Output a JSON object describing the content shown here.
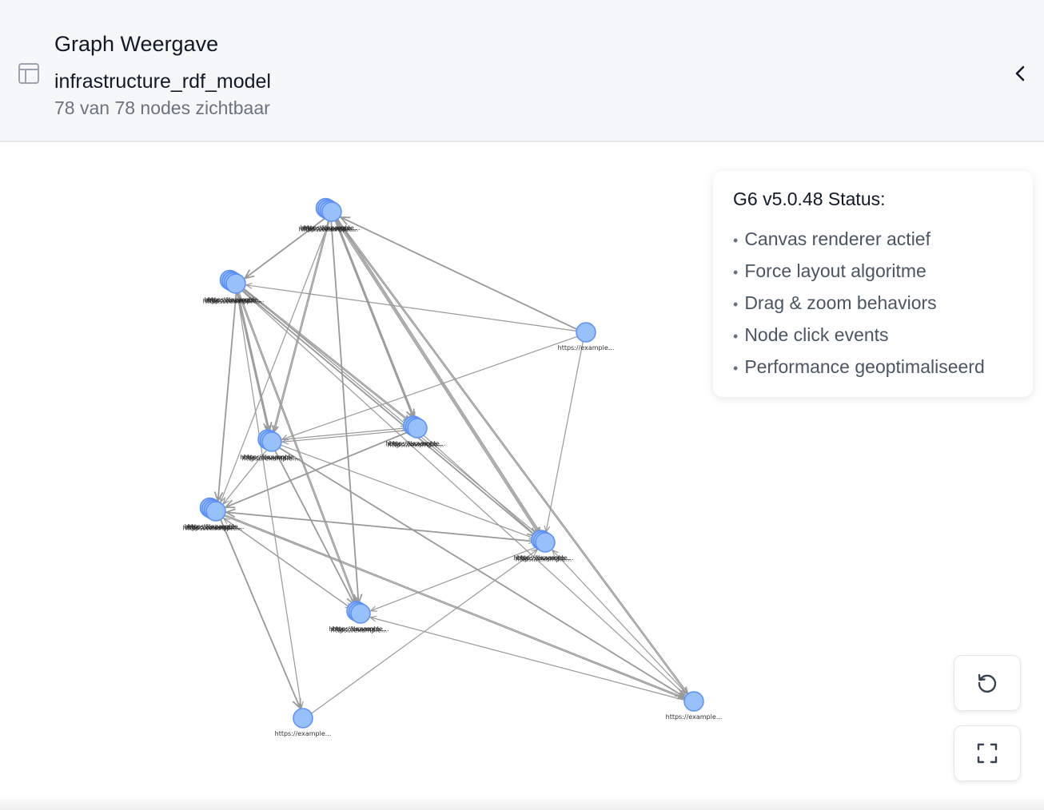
{
  "header": {
    "title": "Graph Weergave",
    "model_name": "infrastructure_rdf_model",
    "node_count": "78 van 78 nodes zichtbaar",
    "layout_icon": "layout-panel-icon",
    "collapse_icon": "chevron-left-icon"
  },
  "status_panel": {
    "title": "G6 v5.0.48 Status:",
    "items": [
      "Canvas renderer actief",
      "Force layout algoritme",
      "Drag & zoom behaviors",
      "Node click events",
      "Performance geoptimaliseerd"
    ]
  },
  "graph": {
    "node_label": "https://example...",
    "node_fill": "#98c0fb",
    "node_stroke": "#5b8ff9",
    "edge_color": "#999999"
  },
  "controls": {
    "reset_icon": "rotate-ccw-icon",
    "fullscreen_icon": "fullscreen-icon"
  }
}
